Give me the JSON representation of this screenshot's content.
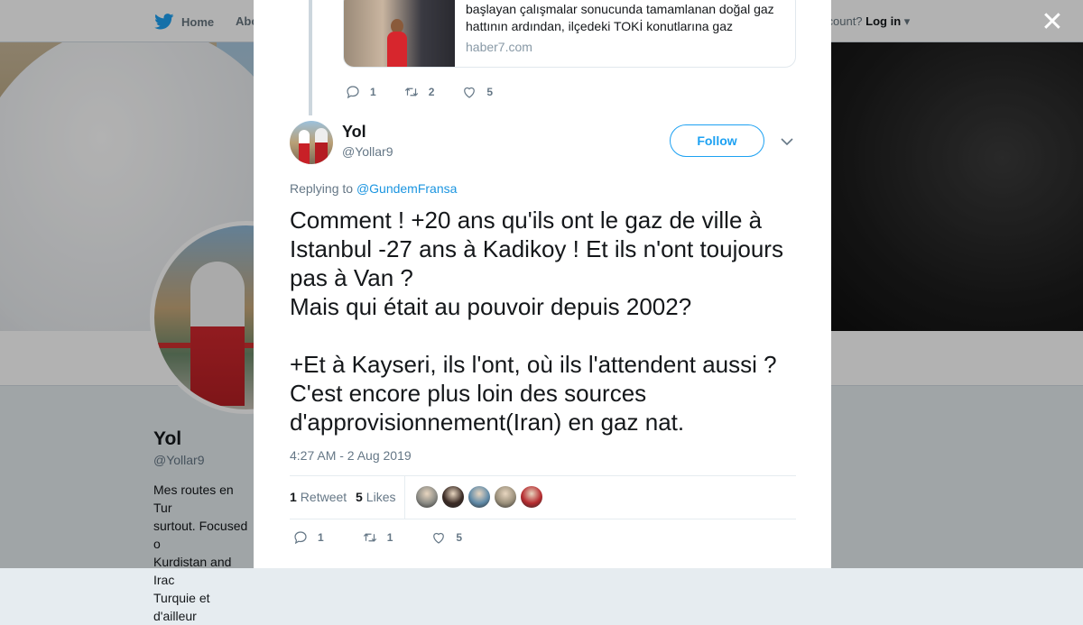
{
  "nav": {
    "home_label": "Home",
    "about_label": "Abo",
    "login_prompt": "ccount?",
    "login_label": "Log in"
  },
  "profile": {
    "name": "Yol",
    "handle": "@Yollar9",
    "bio": "Mes routes en Tur\nsurtout. Focused o\nKurdistan and Irac\nTurquie et d'ailleur"
  },
  "link_card": {
    "text": "başlayan çalışmalar sonucunda tamamlanan doğal gaz hattının ardından, ilçedeki TOKİ konutlarına gaz",
    "domain": "haber7.com"
  },
  "parent_actions": {
    "replies": "1",
    "retweets": "2",
    "likes": "5"
  },
  "tweet": {
    "author_name": "Yol",
    "author_handle": "@Yollar9",
    "follow_label": "Follow",
    "replying_prefix": "Replying to ",
    "replying_to": "@GundemFransa",
    "text": "Comment ! +20 ans qu'ils ont le gaz de ville à Istanbul -27 ans à Kadikoy ! Et ils n'ont toujours pas à Van ?\nMais qui était au pouvoir depuis 2002?\n\n+Et à Kayseri, ils l'ont, où ils l'attendent aussi ? C'est encore plus loin des sources d'approvisionnement(Iran) en gaz nat.",
    "timestamp": "4:27 AM - 2 Aug 2019",
    "retweet_count": "1",
    "retweet_label": "Retweet",
    "like_count": "5",
    "like_label": "Likes"
  },
  "tweet_actions": {
    "replies": "1",
    "retweets": "1",
    "likes": "5"
  },
  "likers": [
    {
      "color": "#8a8a84"
    },
    {
      "color": "#3a2a24"
    },
    {
      "color": "#5f8aa8"
    },
    {
      "color": "#9a8f7a"
    },
    {
      "color": "#b52a2e"
    }
  ],
  "colors": {
    "accent": "#1da1f2",
    "text": "#14171a",
    "muted": "#657786"
  }
}
